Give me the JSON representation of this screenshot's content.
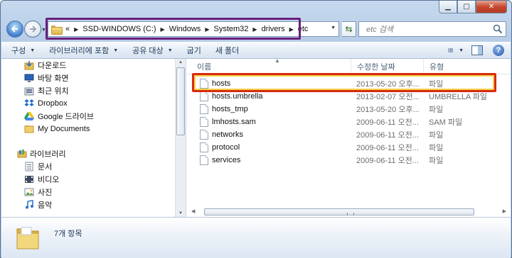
{
  "address": {
    "overflow": "«",
    "crumbs": [
      "SSD-WINDOWS (C:)",
      "Windows",
      "System32",
      "drivers",
      "etc"
    ]
  },
  "search": {
    "placeholder": "etc 검색"
  },
  "toolbar": {
    "organize": "구성",
    "include_in_library": "라이브러리에 포함",
    "share_with": "공유 대상",
    "burn": "굽기",
    "new_folder": "새 폴더"
  },
  "nav": {
    "favorites": [
      {
        "label": "다운로드",
        "icon": "downloads-icon"
      },
      {
        "label": "바탕 화면",
        "icon": "desktop-icon"
      },
      {
        "label": "최근 위치",
        "icon": "recent-places-icon"
      },
      {
        "label": "Dropbox",
        "icon": "dropbox-icon"
      },
      {
        "label": "Google 드라이브",
        "icon": "google-drive-icon"
      },
      {
        "label": "My Documents",
        "icon": "folder-icon"
      }
    ],
    "libraries_label": "라이브러리",
    "libraries": [
      {
        "label": "문서",
        "icon": "documents-icon"
      },
      {
        "label": "비디오",
        "icon": "video-icon"
      },
      {
        "label": "사진",
        "icon": "pictures-icon"
      },
      {
        "label": "음악",
        "icon": "music-icon"
      }
    ]
  },
  "columns": {
    "name": "이름",
    "modified": "수정한 날짜",
    "type": "유형"
  },
  "files": [
    {
      "name": "hosts",
      "modified": "2013-05-20 오후...",
      "type": "파일"
    },
    {
      "name": "hosts.umbrella",
      "modified": "2013-02-07 오전...",
      "type": "UMBRELLA 파일"
    },
    {
      "name": "hosts_tmp",
      "modified": "2013-05-20 오후...",
      "type": "파일"
    },
    {
      "name": "lmhosts.sam",
      "modified": "2009-06-11 오전...",
      "type": "SAM 파일"
    },
    {
      "name": "networks",
      "modified": "2009-06-11 오전...",
      "type": "파일"
    },
    {
      "name": "protocol",
      "modified": "2009-06-11 오전...",
      "type": "파일"
    },
    {
      "name": "services",
      "modified": "2009-06-11 오전...",
      "type": "파일"
    }
  ],
  "details": {
    "item_count": "7개 항목"
  },
  "colors": {
    "address_highlight": "#6a1f7e",
    "hosts_highlight": "#d82a0e",
    "hosts_highlight_inner": "#f2d34a"
  }
}
